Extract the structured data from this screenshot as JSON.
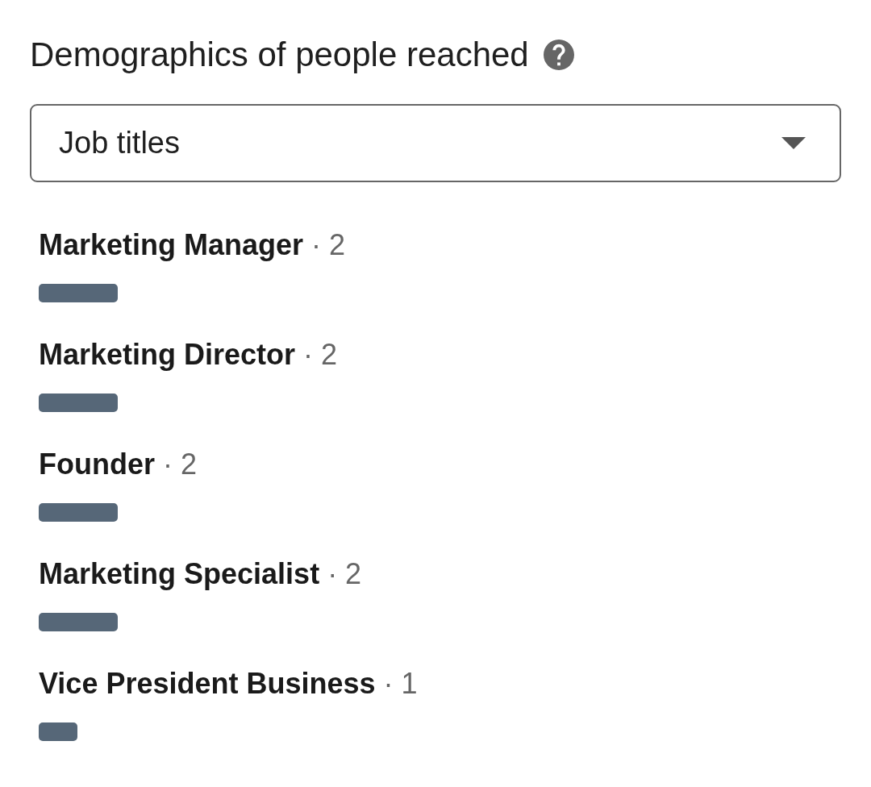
{
  "header": {
    "title": "Demographics of people reached"
  },
  "dropdown": {
    "value": "Job titles"
  },
  "items": [
    {
      "title": "Marketing Manager",
      "count": "· 2",
      "level": 0.098
    },
    {
      "title": "Marketing Director",
      "count": "· 2",
      "level": 0.098
    },
    {
      "title": "Founder",
      "count": "· 2",
      "level": 0.098
    },
    {
      "title": "Marketing Specialist",
      "count": "· 2",
      "level": 0.098
    },
    {
      "title": "Vice President Business",
      "count": "· 1",
      "level": 0.048
    }
  ]
}
